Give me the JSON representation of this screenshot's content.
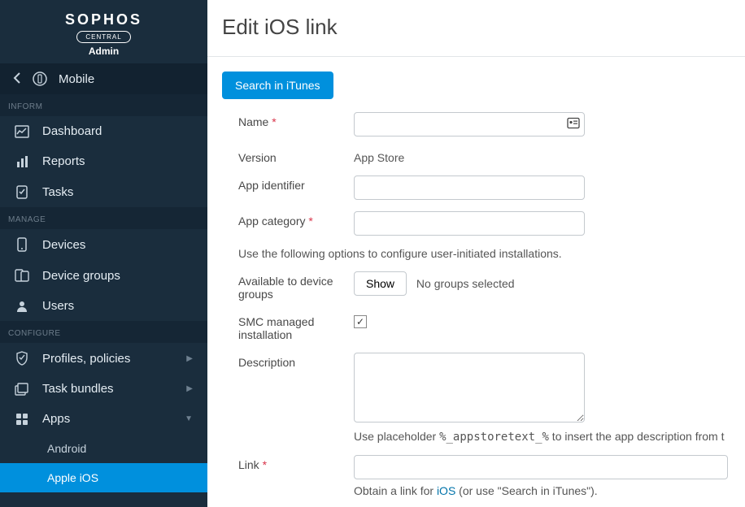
{
  "brand": {
    "name": "SOPHOS",
    "subtitle": "CENTRAL",
    "role": "Admin"
  },
  "context": {
    "label": "Mobile"
  },
  "sections": {
    "inform": {
      "label": "INFORM",
      "items": [
        {
          "label": "Dashboard"
        },
        {
          "label": "Reports"
        },
        {
          "label": "Tasks"
        }
      ]
    },
    "manage": {
      "label": "MANAGE",
      "items": [
        {
          "label": "Devices"
        },
        {
          "label": "Device groups"
        },
        {
          "label": "Users"
        }
      ]
    },
    "configure": {
      "label": "CONFIGURE",
      "items": [
        {
          "label": "Profiles, policies"
        },
        {
          "label": "Task bundles"
        },
        {
          "label": "Apps"
        }
      ],
      "apps_children": [
        {
          "label": "Android"
        },
        {
          "label": "Apple iOS",
          "active": true
        }
      ]
    }
  },
  "page": {
    "title": "Edit iOS link",
    "search_button": "Search in iTunes",
    "labels": {
      "name": "Name",
      "version": "Version",
      "app_identifier": "App identifier",
      "app_category": "App category",
      "available_groups": "Available to device groups",
      "smc_managed": "SMC managed installation",
      "description": "Description",
      "link": "Link"
    },
    "values": {
      "name": "",
      "version": "App Store",
      "app_identifier": "",
      "app_category": "",
      "groups_note": "No groups selected",
      "show_button": "Show",
      "smc_checked": true,
      "description": "",
      "link": ""
    },
    "hints": {
      "config_line": "Use the following options to configure user-initiated installations.",
      "placeholder_prefix": "Use placeholder ",
      "placeholder_token": "%_appstoretext_%",
      "placeholder_suffix": " to insert the app description from t",
      "link_prefix": "Obtain a link for ",
      "link_os": "iOS",
      "link_suffix": " (or use \"Search in iTunes\")."
    }
  }
}
